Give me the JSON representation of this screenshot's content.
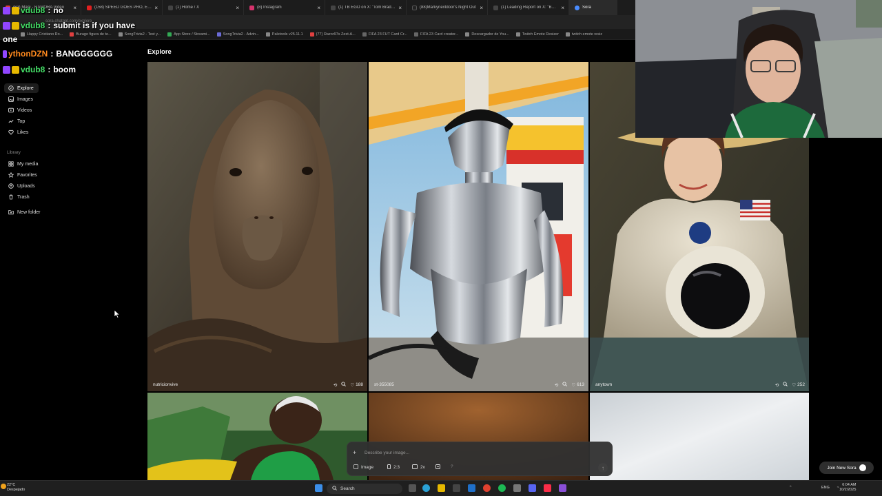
{
  "browser": {
    "tabs": [
      {
        "label": "(63) Mam - RAMORA Video",
        "color": "#e03c3c"
      },
      {
        "label": "(158) SPEED GOES PRO, EPISODE",
        "color": "#e02020"
      },
      {
        "label": "(1) Home / X",
        "color": "#444"
      },
      {
        "label": "(8) Instagram",
        "color": "#d6336c"
      },
      {
        "label": "(1) TB EGO on X: \"Tom Brady is",
        "color": "#444"
      },
      {
        "label": "(88)Markynextdoor's Night Out",
        "color": "#222"
      },
      {
        "label": "(1) Leading Report on X: \"BREAKI",
        "color": "#444"
      },
      {
        "label": "Sora",
        "color": "#4a8cff"
      }
    ],
    "url": "sora.chatgpt.com/explore",
    "bookmarks": [
      {
        "label": "Happy Cristiano Ro...",
        "color": "#888"
      },
      {
        "label": "Burago figura de te...",
        "color": "#e04040"
      },
      {
        "label": "SongTrivia2 - Test y...",
        "color": "#888"
      },
      {
        "label": "App Store / Streami...",
        "color": "#33aa55"
      },
      {
        "label": "SongTrivia2 - Advin...",
        "color": "#6b6bd6"
      },
      {
        "label": "Paletools v25.11.1",
        "color": "#888"
      },
      {
        "label": "(77) Razor97s Zest-A...",
        "color": "#e04040"
      },
      {
        "label": "FIFA 23 FUT Card Cr...",
        "color": "#666"
      },
      {
        "label": "FIFA 23 Card creator...",
        "color": "#666"
      },
      {
        "label": "Descargador de You...",
        "color": "#888"
      },
      {
        "label": "Twitch Emote Resizer",
        "color": "#888"
      },
      {
        "label": "twitch emote resiz",
        "color": "#888"
      }
    ]
  },
  "chat": [
    {
      "user": "vdub8",
      "sep": ":",
      "text": "no",
      "color": "#44dd66"
    },
    {
      "user": "vdub8",
      "sep": ":",
      "text": "submit is if you have",
      "color": "#44dd66"
    },
    {
      "user": "",
      "sep": "",
      "text": "one",
      "color": "#ffffff"
    },
    {
      "user": "ythonDZN",
      "sep": ":",
      "text": "BANGGGGGG",
      "color": "#ff8a1e"
    },
    {
      "user": "vdub8",
      "sep": ":",
      "text": "boom",
      "color": "#44dd66"
    }
  ],
  "sidebar": {
    "nav": [
      {
        "label": "Explore",
        "icon": "compass-icon"
      },
      {
        "label": "Images",
        "icon": "image-icon"
      },
      {
        "label": "Videos",
        "icon": "video-icon"
      },
      {
        "label": "Top",
        "icon": "trending-icon"
      },
      {
        "label": "Likes",
        "icon": "heart-icon"
      }
    ],
    "library_label": "Library",
    "library": [
      {
        "label": "My media",
        "icon": "grid-icon"
      },
      {
        "label": "Favorites",
        "icon": "star-icon"
      },
      {
        "label": "Uploads",
        "icon": "upload-icon"
      },
      {
        "label": "Trash",
        "icon": "trash-icon"
      }
    ],
    "new_folder": "New folder"
  },
  "main": {
    "title": "Explore",
    "cards": [
      {
        "user": "nutricionvive",
        "likes": "188"
      },
      {
        "user": "st-355085",
        "likes": "613"
      },
      {
        "user": "anytown",
        "likes": "252"
      }
    ]
  },
  "prompt": {
    "placeholder": "Describe your image...",
    "type": "Image",
    "aspect": "2:3",
    "variations": "2v",
    "help": "?"
  },
  "join_button": "Join New Sora",
  "taskbar": {
    "temp": "22°C",
    "weather": "Despejado",
    "search": "Search",
    "lang": "ENG",
    "time": "6:04 AM",
    "date": "10/2/2025"
  }
}
